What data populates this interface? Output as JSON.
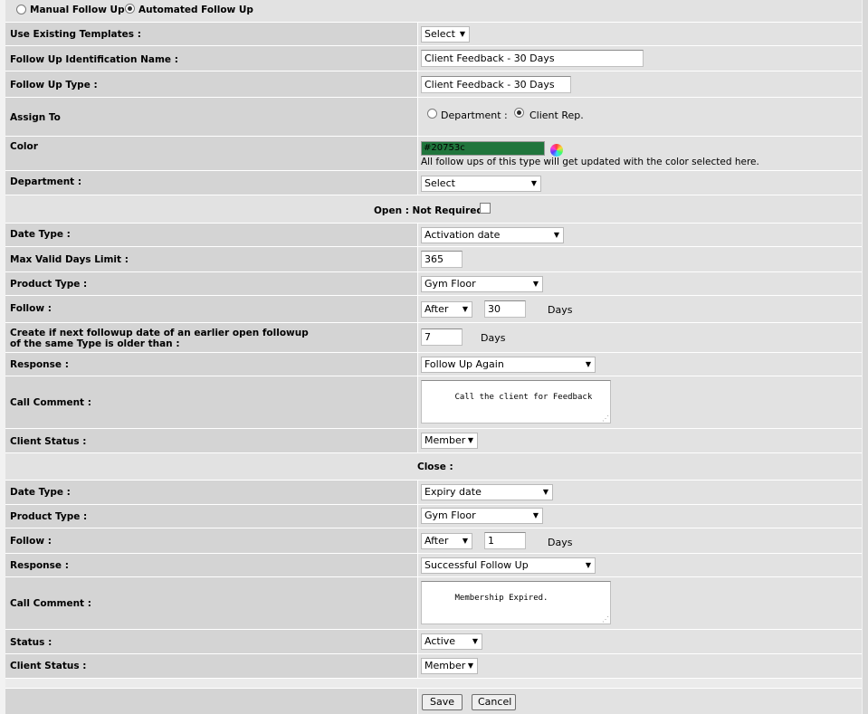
{
  "mode": {
    "manual_label": "Manual Follow Up",
    "automated_label": "Automated Follow Up",
    "selected": "automated"
  },
  "fields": {
    "templates": {
      "label": "Use Existing Templates :",
      "value": "Select"
    },
    "identification": {
      "label": "Follow Up Identification Name :",
      "value": "Client Feedback - 30 Days"
    },
    "type": {
      "label": "Follow Up Type :",
      "value": "Client Feedback - 30 Days"
    },
    "assign": {
      "label": "Assign To",
      "department_label": "Department :",
      "client_rep_label": "Client Rep.",
      "selected": "client_rep"
    },
    "color": {
      "label": "Color",
      "value": "#20753c",
      "swatch": "#20753c",
      "note": "All follow ups of this type will get updated with the color selected here."
    },
    "department": {
      "label": "Department :",
      "value": "Select"
    }
  },
  "open": {
    "header": "Open : Not Required",
    "date_type": {
      "label": "Date Type :",
      "value": "Activation date"
    },
    "max_days": {
      "label": "Max Valid Days Limit :",
      "value": "365"
    },
    "product_type": {
      "label": "Product Type :",
      "value": "Gym Floor"
    },
    "follow": {
      "label": "Follow :",
      "when": "After",
      "count": "30",
      "unit": "Days"
    },
    "create_if": {
      "label_line1": "Create if next followup date of an earlier open followup",
      "label_line2": "of the same Type is older than :",
      "value": "7",
      "unit": "Days"
    },
    "response": {
      "label": "Response :",
      "value": "Follow Up Again"
    },
    "call_comment": {
      "label": "Call Comment :",
      "value": "Call the client for Feedback"
    },
    "client_status": {
      "label": "Client Status :",
      "value": "Member"
    }
  },
  "close": {
    "header": "Close :",
    "date_type": {
      "label": "Date Type :",
      "value": "Expiry date"
    },
    "product_type": {
      "label": "Product Type :",
      "value": "Gym Floor"
    },
    "follow": {
      "label": "Follow :",
      "when": "After",
      "count": "1",
      "unit": "Days"
    },
    "response": {
      "label": "Response :",
      "value": "Successful Follow Up"
    },
    "call_comment": {
      "label": "Call Comment :",
      "value": "Membership Expired."
    },
    "status": {
      "label": "Status :",
      "value": "Active"
    },
    "client_status": {
      "label": "Client Status :",
      "value": "Member"
    }
  },
  "actions": {
    "save": "Save",
    "cancel": "Cancel"
  }
}
